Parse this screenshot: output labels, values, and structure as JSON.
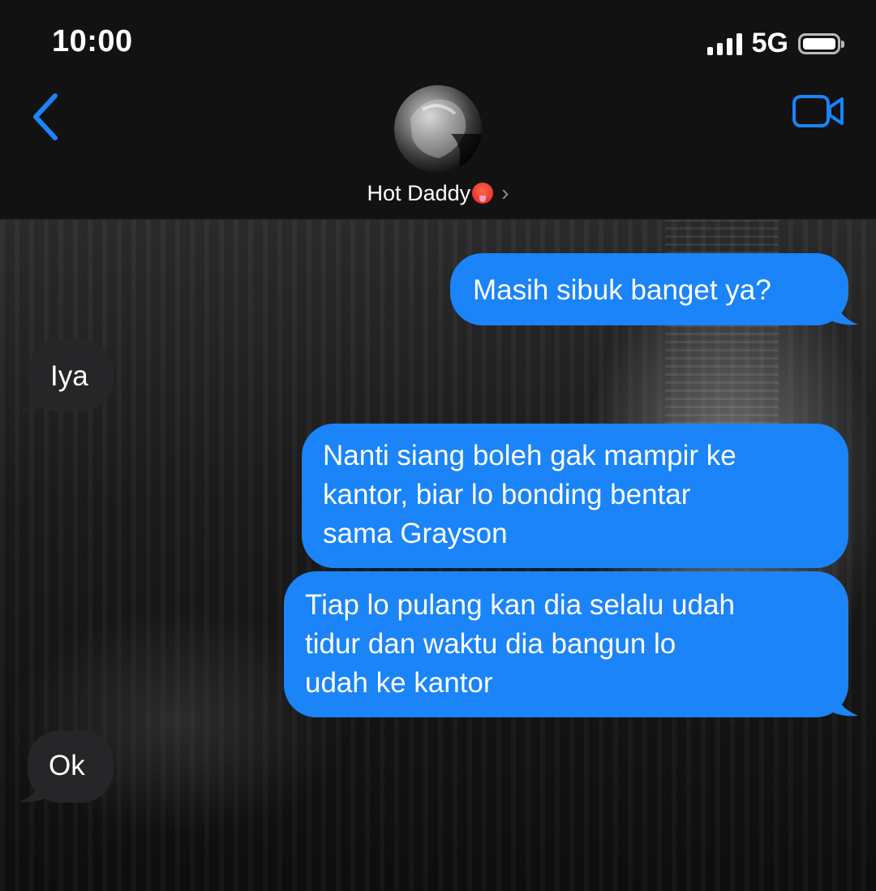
{
  "status_bar": {
    "time": "10:00",
    "network": "5G",
    "battery_level": 1.0
  },
  "header": {
    "contact_name": "Hot Daddy",
    "contact_emoji": "hot-face-emoji",
    "chevron": "›",
    "back_icon": "chevron-left-icon",
    "video_icon": "video-camera-icon"
  },
  "messages": [
    {
      "direction": "sent",
      "text": "Masih sibuk banget ya?"
    },
    {
      "direction": "received",
      "text": "Iya"
    },
    {
      "direction": "sent",
      "text": "Nanti siang boleh gak mampir ke\nkantor, biar lo bonding bentar\nsama Grayson"
    },
    {
      "direction": "sent",
      "text": "Tiap lo pulang kan dia selalu udah\ntidur dan waktu dia bangun lo\nudah ke kantor"
    },
    {
      "direction": "received",
      "text": "Ok"
    }
  ],
  "colors": {
    "sent_bubble": "#1a84f8",
    "received_bubble": "#262628",
    "accent": "#1a84f8"
  }
}
